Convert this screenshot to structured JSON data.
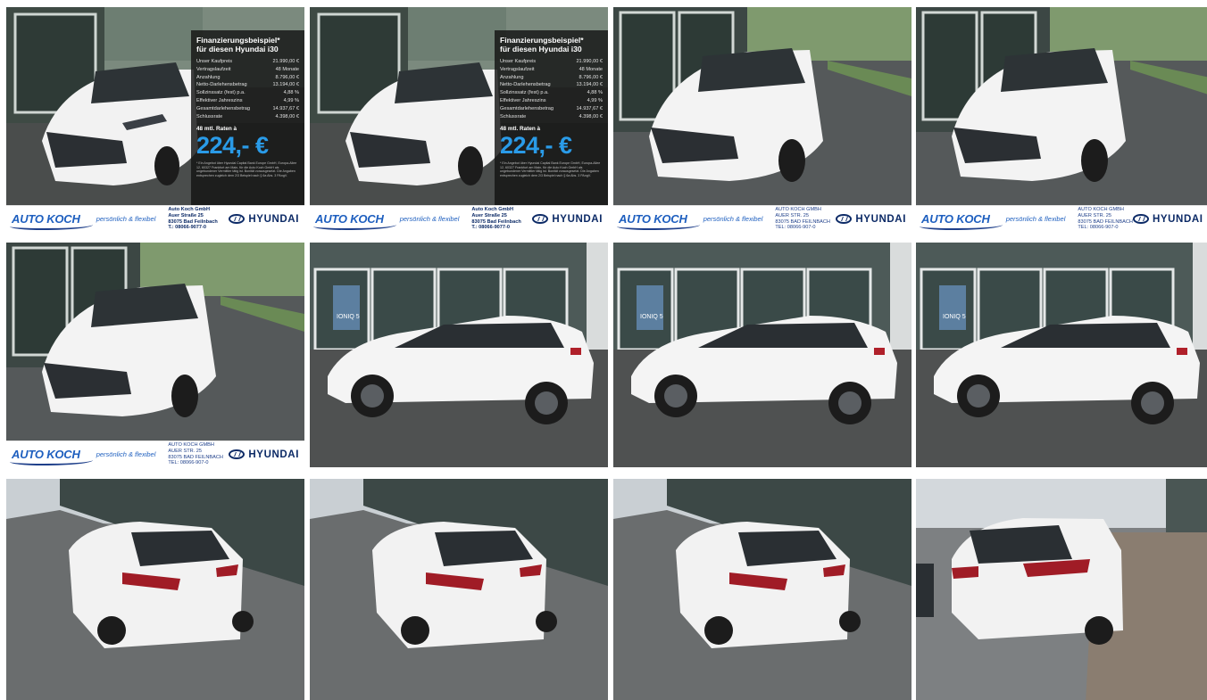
{
  "finance": {
    "title_line1": "Finanzierungsbeispiel*",
    "title_line2": "für diesen Hyundai i30",
    "rows": [
      {
        "label": "Unser Kaufpreis",
        "value": "21.990,00 €"
      },
      {
        "label": "Vertragslaufzeit",
        "value": "48 Monate"
      },
      {
        "label": "Anzahlung",
        "value": "8.796,00 €"
      },
      {
        "label": "Netto-Darlehensbetrag",
        "value": "13.194,00 €"
      },
      {
        "label": "Sollzinssatz (fest) p.a.",
        "value": "4,88 %"
      },
      {
        "label": "Effektiver Jahreszins",
        "value": "4,99 %"
      },
      {
        "label": "Gesamtdarlehensbetrag",
        "value": "14.937,67 €"
      },
      {
        "label": "Schlussrate",
        "value": "4.398,00 €"
      }
    ],
    "rate_label": "48 mtl. Raten à",
    "rate_value": "224,- €",
    "small_print": "* Ein Angebot über Hyundai Capital Bank Europe GmbH, Europa-Allee 12, 60327 Frankfurt am Main, für die Auto Koch GmbH als ungebundener Vermittler tätig ist. Bonität vorausgesetzt. Die Angaben entsprechen zugleich dem 2/3 Beispiel nach § 6a Abs. 3 PAngV."
  },
  "banner": {
    "logo": "AUTO KOCH",
    "slogan": "persönlich & flexibel",
    "brand": "HYUNDAI",
    "address_v1": [
      "Auto Koch GmbH",
      "Auer Straße 25",
      "83075 Bad Feilnbach",
      "T.: 08066-9077-0"
    ],
    "address_v2": [
      "AUTO KOCH GMBH",
      "AUER STR. 25",
      "83075 BAD FEILNBACH",
      "TEL: 08066-907-0"
    ]
  },
  "scene_text": {
    "poster_model": "IONIQ 5"
  },
  "colors": {
    "brand_blue": "#1e5fbf",
    "rate_blue": "#2a9be8",
    "hyundai_navy": "#0c2a66"
  }
}
